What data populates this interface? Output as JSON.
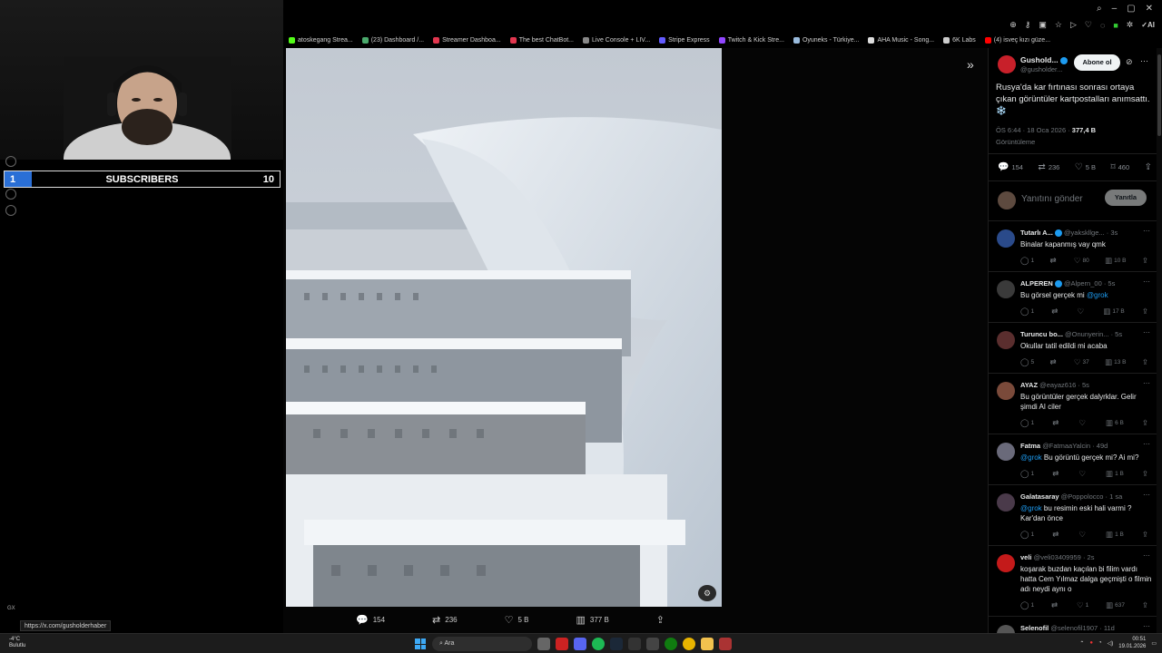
{
  "overlay": {
    "subscribers": {
      "current": "1",
      "label": "SUBSCRIBERS",
      "goal": "10",
      "progress": 0.1
    }
  },
  "bookmarks": [
    {
      "label": "atoskegang Strea...",
      "color": "#53fc18"
    },
    {
      "label": "(23) Dashboard /...",
      "color": "#4aa96c"
    },
    {
      "label": "Streamer Dashboa...",
      "color": "#e2364f"
    },
    {
      "label": "The best ChatBot...",
      "color": "#e2364f"
    },
    {
      "label": "Live Console + LIV...",
      "color": "#888888"
    },
    {
      "label": "Stripe Express",
      "color": "#635bff"
    },
    {
      "label": "Twitch & Kick Stre...",
      "color": "#9146ff"
    },
    {
      "label": "Oyuneks - Türkiye...",
      "color": "#9bd"
    },
    {
      "label": "AHA Music - Song...",
      "color": "#ddd"
    },
    {
      "label": "6K Labs",
      "color": "#ccc"
    },
    {
      "label": "(4) isveç kızı güze...",
      "color": "#ff0000"
    }
  ],
  "browser": {
    "ai_label": "AI"
  },
  "media": {
    "actions": {
      "replies": "154",
      "reposts": "236",
      "likes": "5 B",
      "views": "377 B"
    }
  },
  "post": {
    "author_name": "Gushold...",
    "author_handle": "@gusholder...",
    "follow_label": "Abone ol",
    "text": "Rusya'da kar fırtınası sonrası ortaya çıkan görüntüler kartpostalları anımsattı. ❄️",
    "time": "ÖS 6:44 · 18 Oca 2026 · ",
    "views_count": "377,4 B",
    "views_label": "Görüntüleme",
    "stats": {
      "replies": "154",
      "reposts": "236",
      "likes": "5 B",
      "bookmarks": "460"
    },
    "reply_placeholder": "Yanıtını gönder",
    "reply_button": "Yanıtla"
  },
  "comments": [
    {
      "name": "Tutarlı A...",
      "verified": true,
      "handle": "@yakskllge...",
      "time": "· 3s",
      "text": "Binalar kapanmış vay qmk",
      "mention": "",
      "replies": "1",
      "reposts": "",
      "likes": "80",
      "views": "10 B",
      "avatar": "#2a4a8a"
    },
    {
      "name": "ALPEREN",
      "verified": true,
      "handle": "@Alpern_00",
      "time": "· 5s",
      "text": "Bu görsel gerçek mi",
      "mention": "@grok",
      "mention_first": false,
      "replies": "1",
      "reposts": "",
      "likes": "",
      "views": "17 B",
      "avatar": "#3a3a3a"
    },
    {
      "name": "Turuncu bo...",
      "verified": false,
      "handle": "@Onunyerin...",
      "time": "· 5s",
      "text": "Okullar tatil edildi mi acaba",
      "mention": "",
      "replies": "5",
      "reposts": "",
      "likes": "37",
      "views": "13 B",
      "avatar": "#5a2e2e"
    },
    {
      "name": "AYAZ",
      "verified": false,
      "handle": "@eayaz616",
      "time": "· 5s",
      "text": "Bu görüntüler gerçek dalyrklar. Gelir şimdi AI ciler",
      "mention": "",
      "replies": "1",
      "reposts": "",
      "likes": "",
      "views": "6 B",
      "avatar": "#7a4a3a"
    },
    {
      "name": "Fatma",
      "verified": false,
      "handle": "@FatmaaYalcin",
      "time": "· 49d",
      "text": " Bu görüntü gerçek mi? Ai mi?",
      "mention": "@grok",
      "mention_first": true,
      "replies": "1",
      "reposts": "",
      "likes": "",
      "views": "1 B",
      "avatar": "#6a6a7a"
    },
    {
      "name": "Galatasaray",
      "verified": false,
      "handle": "@Poppolocco",
      "time": "· 1 sa",
      "text": " bu resimin eski hali varmi ? Kar'dan önce",
      "mention": "@grok",
      "mention_first": true,
      "replies": "1",
      "reposts": "",
      "likes": "",
      "views": "1 B",
      "avatar": "#4a3a4a"
    },
    {
      "name": "veli",
      "verified": false,
      "handle": "@veli03409959",
      "time": "· 2s",
      "text": "koşarak buzdan kaçılan bi filim vardı hatta Cem Yılmaz dalga geçmişti o filmin adı neydi aynı o",
      "mention": "",
      "replies": "1",
      "reposts": "",
      "likes": "1",
      "views": "637",
      "avatar": "#c41a1a"
    },
    {
      "name": "Selenofil",
      "verified": false,
      "handle": "@selenofil1907",
      "time": "· 11d",
      "text": "",
      "mention": "",
      "replies": "",
      "reposts": "",
      "likes": "",
      "views": "",
      "avatar": "#555"
    }
  ],
  "status": {
    "url": "https://x.com/gusholderhaber",
    "gx": "GX"
  },
  "taskbar": {
    "temp": "-4°C",
    "weather": "Bulutlu",
    "search_placeholder": "Ara",
    "time": "00:51",
    "date": "19.01.2026"
  }
}
